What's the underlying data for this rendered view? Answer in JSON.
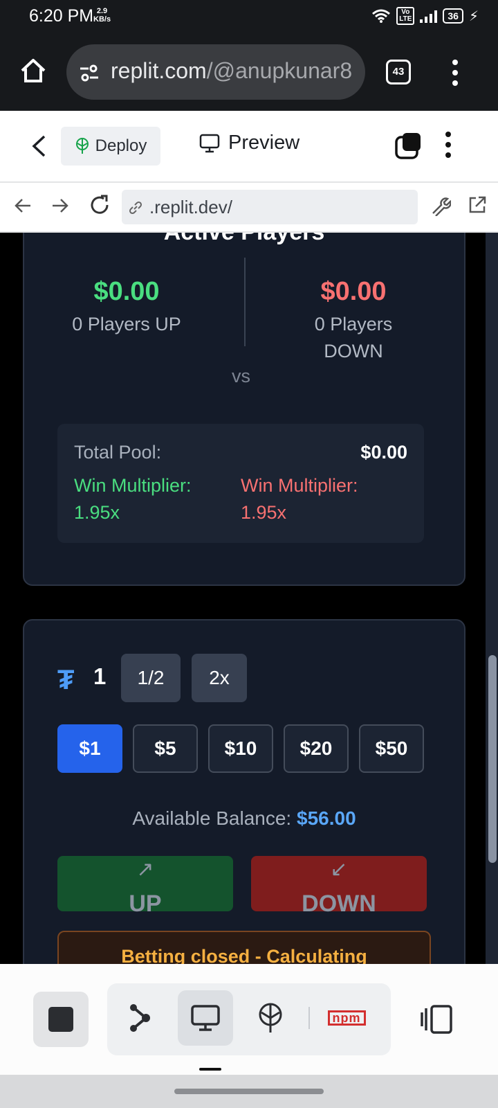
{
  "status": {
    "time": "6:20 PM",
    "speed_value": "2.9",
    "speed_unit": "KB/s",
    "volte": "Vo\nLTE",
    "battery": "36"
  },
  "browser": {
    "url_main": "replit.com",
    "url_path": "/@anupkunar8",
    "tab_count": "43"
  },
  "replit_header": {
    "deploy_label": "Deploy",
    "preview_label": "Preview"
  },
  "url_row": {
    "address": ".replit.dev/"
  },
  "active_players": {
    "title": "Active Players",
    "up": {
      "amount": "$0.00",
      "label": "0 Players UP",
      "color": "#4ade80"
    },
    "down": {
      "amount": "$0.00",
      "label": "0 Players DOWN",
      "color": "#f87171"
    },
    "vs": "vs",
    "pool": {
      "total_label": "Total Pool:",
      "total_value": "$0.00",
      "up_multiplier_label": "Win Multiplier:",
      "up_multiplier_value": "1.95x",
      "down_multiplier_label": "Win Multiplier:",
      "down_multiplier_value": "1.95x"
    }
  },
  "bet": {
    "currency_symbol": "₮",
    "quantity": "1",
    "half_label": "1/2",
    "double_label": "2x",
    "amounts": [
      "$1",
      "$5",
      "$10",
      "$20",
      "$50"
    ],
    "selected_amount": "$1",
    "balance_label": "Available Balance:",
    "balance_value": "$56.00",
    "up_label": "UP",
    "down_label": "DOWN",
    "up_arrow": "↗",
    "down_arrow": "↙",
    "notice": "Betting closed - Calculating"
  },
  "bottom_tools": {
    "npm_label": "npm"
  },
  "colors": {
    "accent_blue": "#2563eb",
    "up_button": "#14532d",
    "down_button": "#7f1d1d"
  }
}
